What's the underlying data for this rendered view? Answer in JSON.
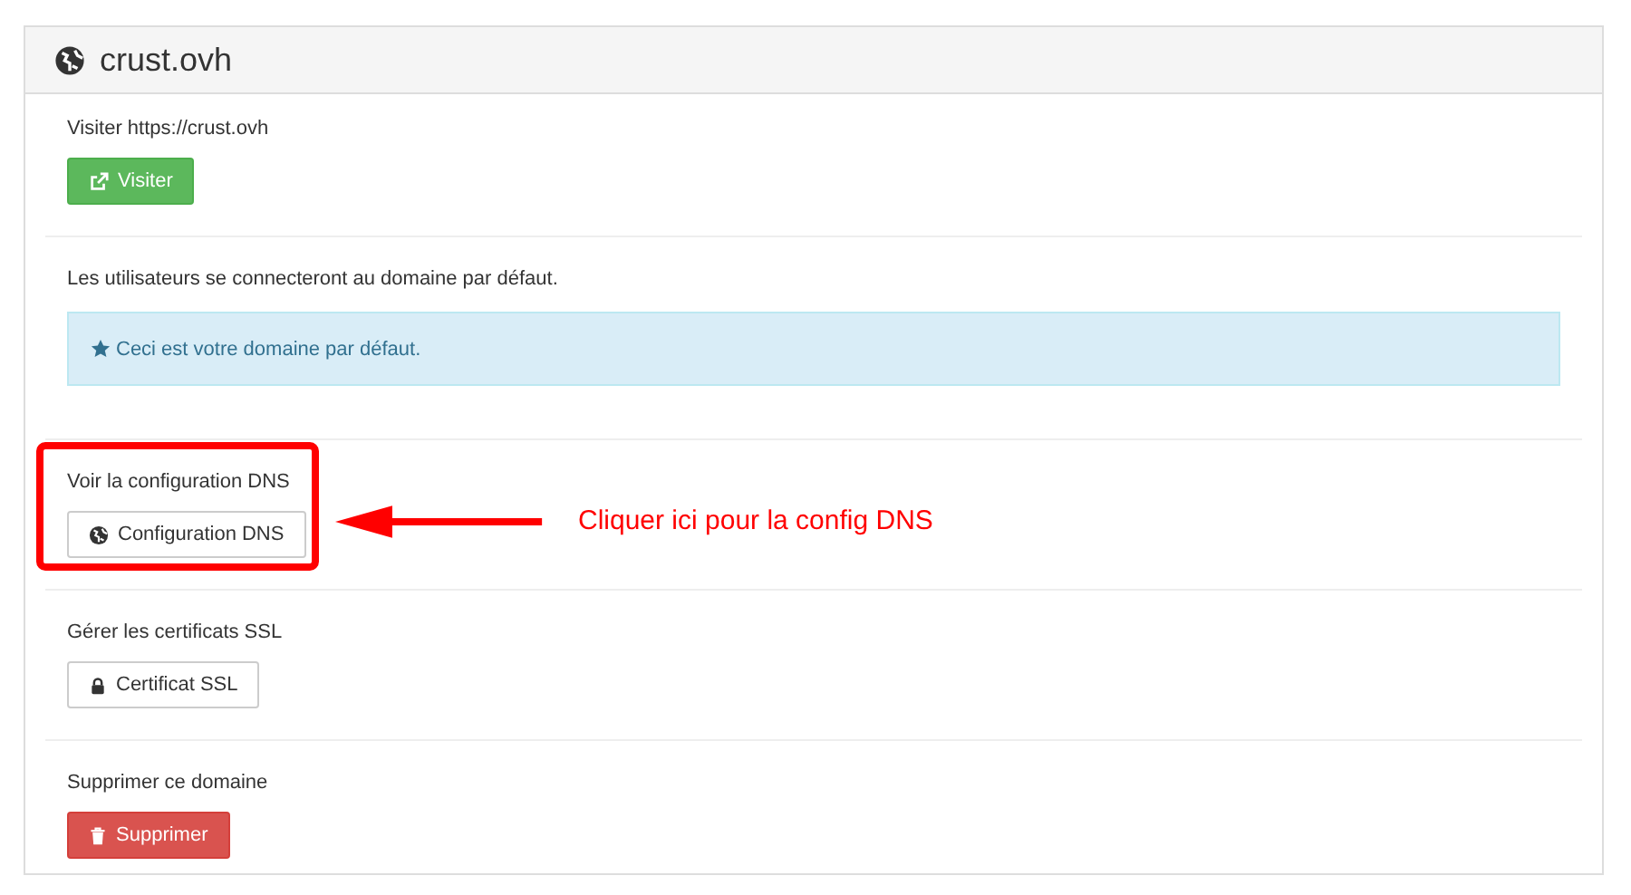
{
  "panel": {
    "title": "crust.ovh"
  },
  "sections": [
    {
      "label": "Visiter https://crust.ovh",
      "kind": "visit",
      "action": "Visiter"
    },
    {
      "label": "Les utilisateurs se connecteront au domaine par défaut.",
      "kind": "notice",
      "action": "Ceci est votre domaine par défaut."
    },
    {
      "label": "Voir la configuration DNS",
      "kind": "dns",
      "action": "Configuration DNS",
      "callout": "Cliquer ici pour la config DNS"
    },
    {
      "label": "Gérer les certificats SSL",
      "kind": "ssl",
      "action": "Certificat SSL"
    },
    {
      "label": "Supprimer ce domaine",
      "kind": "delete",
      "action": "Supprimer"
    }
  ]
}
